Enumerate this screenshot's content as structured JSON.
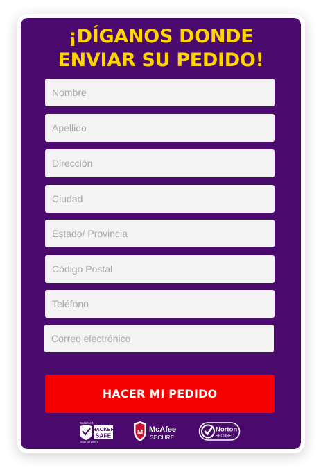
{
  "form": {
    "headline_line1": "¡DÍGANOS DONDE",
    "headline_line2": "ENVIAR SU PEDIDO!",
    "fields": [
      {
        "placeholder": "Nombre",
        "value": ""
      },
      {
        "placeholder": "Apellido",
        "value": ""
      },
      {
        "placeholder": "Dirección",
        "value": ""
      },
      {
        "placeholder": "Ciudad",
        "value": ""
      },
      {
        "placeholder": "Estado/ Provincia",
        "value": ""
      },
      {
        "placeholder": "Código Postal",
        "value": ""
      },
      {
        "placeholder": "Teléfono",
        "value": ""
      },
      {
        "placeholder": "Correo electrónico",
        "value": ""
      }
    ],
    "submit_label": "HACER MI PEDIDO"
  },
  "trust_badges": {
    "hacker_safe": {
      "top": "ScanAlert",
      "line1": "HACKER",
      "line2": "SAFE",
      "bottom": "TESTED DAILY"
    },
    "mcafee": {
      "brand": "McAfee",
      "sub": "SECURE"
    },
    "norton": {
      "brand": "Norton",
      "sub": "SECURED"
    }
  },
  "colors": {
    "panel": "#4b0a6e",
    "headline": "#ffd500",
    "button": "#f40000",
    "field": "#f3f3f3"
  }
}
